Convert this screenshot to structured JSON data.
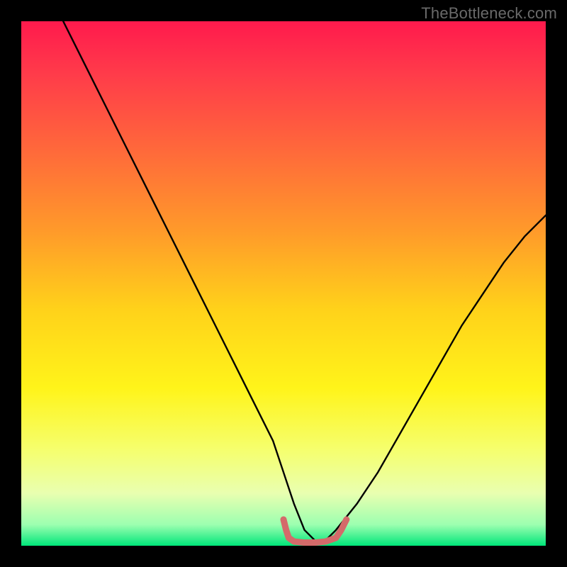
{
  "watermark": "TheBottleneck.com",
  "chart_data": {
    "type": "line",
    "title": "",
    "xlabel": "",
    "ylabel": "",
    "xlim": [
      0,
      100
    ],
    "ylim": [
      0,
      100
    ],
    "grid": false,
    "series": [
      {
        "name": "bottleneck-curve",
        "x": [
          8,
          12,
          16,
          20,
          24,
          28,
          32,
          36,
          40,
          44,
          48,
          50,
          52,
          54,
          56,
          58,
          60,
          64,
          68,
          72,
          76,
          80,
          84,
          88,
          92,
          96,
          100
        ],
        "y": [
          100,
          92,
          84,
          76,
          68,
          60,
          52,
          44,
          36,
          28,
          20,
          14,
          8,
          3,
          1,
          1,
          3,
          8,
          14,
          21,
          28,
          35,
          42,
          48,
          54,
          59,
          63
        ]
      },
      {
        "name": "optimal-range-bracket",
        "x": [
          50,
          50.5,
          51,
          52,
          54,
          56,
          58,
          60,
          61,
          61.5,
          62
        ],
        "y": [
          5,
          3,
          1.5,
          0.8,
          0.6,
          0.6,
          0.8,
          1.5,
          3,
          4,
          5
        ]
      }
    ],
    "colors": {
      "curve": "#000000",
      "bracket": "#d46a6a",
      "gradient_top": "#ff1a4d",
      "gradient_bottom": "#00e67a"
    }
  }
}
